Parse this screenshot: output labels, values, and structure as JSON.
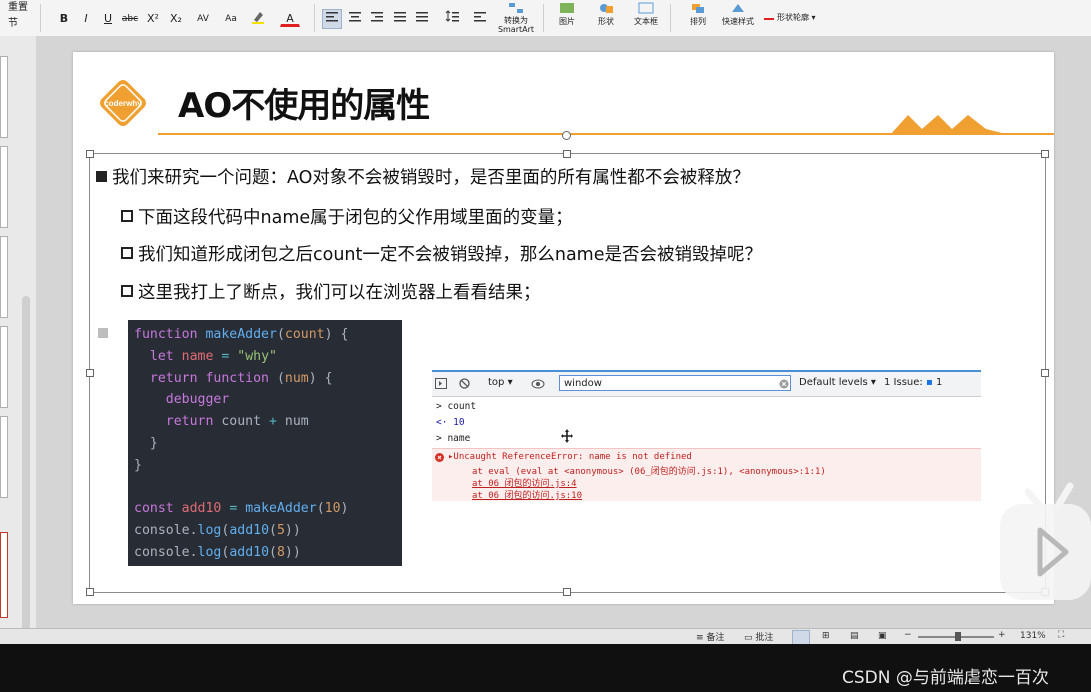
{
  "ribbon": {
    "reset_label": "重置",
    "section_label": "节",
    "bold": "B",
    "italic": "I",
    "underline": "U",
    "strike": "abc",
    "superscript": "X²",
    "subscript": "X₂",
    "spacing": "AV",
    "case": "Aa",
    "font_color": "A",
    "convert_smartart": "转换为\nSmartArt",
    "picture": "图片",
    "shape": "形状",
    "textbox": "文本框",
    "arrange": "排列",
    "quick_style": "快速样式",
    "shape_outline": "形状轮廓"
  },
  "slide": {
    "logo_text": "coderwhy",
    "title": "AO不使用的属性",
    "bullet_main": "我们来研究一个问题：AO对象不会被销毁时，是否里面的所有属性都不会被释放？",
    "sub_bullets": [
      "下面这段代码中name属于闭包的父作用域里面的变量；",
      "我们知道形成闭包之后count一定不会被销毁掉，那么name是否会被销毁掉呢？",
      "这里我打上了断点，我们可以在浏览器上看看结果；"
    ]
  },
  "devtools": {
    "context": "top",
    "filter_value": "window",
    "levels": "Default levels",
    "issues": "1 Issue:",
    "issue_count": "1",
    "rows": [
      ">  count",
      "<·  10",
      ">  name"
    ],
    "error_title": "▸Uncaught ReferenceError: name is not defined",
    "error_lines": [
      "at eval (eval at <anonymous> (06_闭包的访问.js:1), <anonymous>:1:1)",
      "at 06_闭包的访问.js:4",
      "at 06_闭包的访问.js:10"
    ]
  },
  "status_bar": {
    "notes": "备注",
    "comments": "批注",
    "zoom": "131%"
  },
  "overlay": {
    "watermark": "CSDN @与前端虐恋一百次"
  },
  "colors": {
    "accent_orange": "#f0a030",
    "code_bg": "#282c34",
    "error_bg": "#fdeeee"
  }
}
